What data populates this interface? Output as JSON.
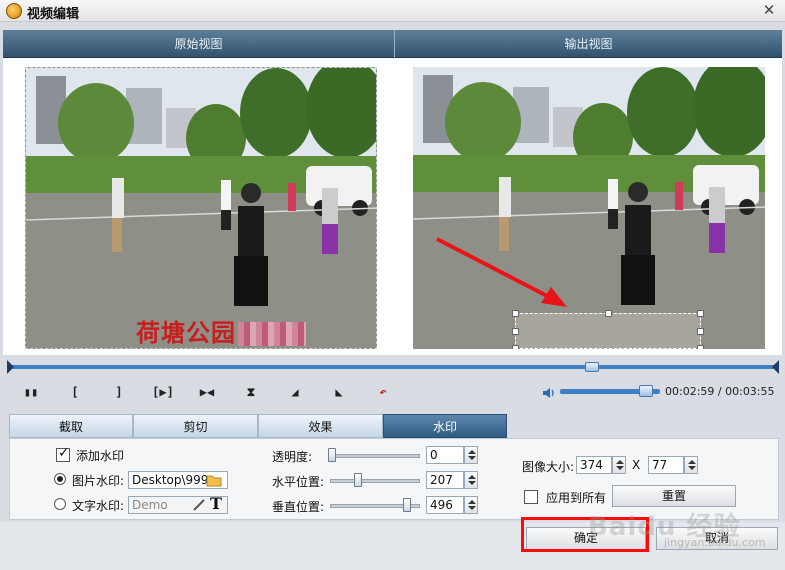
{
  "window": {
    "title": "视频编辑",
    "close_glyph": "✕"
  },
  "views": {
    "original": "原始视图",
    "output": "输出视图"
  },
  "overlay": {
    "watermark_text": "荷塘公园"
  },
  "playback": {
    "time_current": "00:02:59",
    "time_total": "00:03:55",
    "progress": 0.76,
    "volume": 0.86
  },
  "tabs": [
    {
      "label": "截取"
    },
    {
      "label": "剪切"
    },
    {
      "label": "效果"
    },
    {
      "label": "水印"
    }
  ],
  "watermark": {
    "add_label": "添加水印",
    "add_checked": true,
    "image_label": "图片水印:",
    "image_path": "Desktop\\999.",
    "text_label": "文字水印:",
    "text_placeholder": "Demo",
    "selected_mode": "image"
  },
  "adjust": {
    "opacity_label": "透明度:",
    "opacity_value": "0",
    "horizontal_label": "水平位置:",
    "horizontal_value": "207",
    "vertical_label": "垂直位置:",
    "vertical_value": "496"
  },
  "size": {
    "label": "图像大小:",
    "width": "374",
    "x_sep": "X",
    "height": "77",
    "apply_all_label": "应用到所有",
    "reset_label": "重置"
  },
  "footer": {
    "ok_label": "确定",
    "cancel_label": "取消"
  },
  "site_watermark": {
    "brand": "Baidu 经验",
    "url": "jingyan.baidu.com"
  },
  "colors": {
    "accent": "#2f5c85",
    "highlight": "#ff0a0a",
    "watermark_red": "#c81e1e"
  }
}
